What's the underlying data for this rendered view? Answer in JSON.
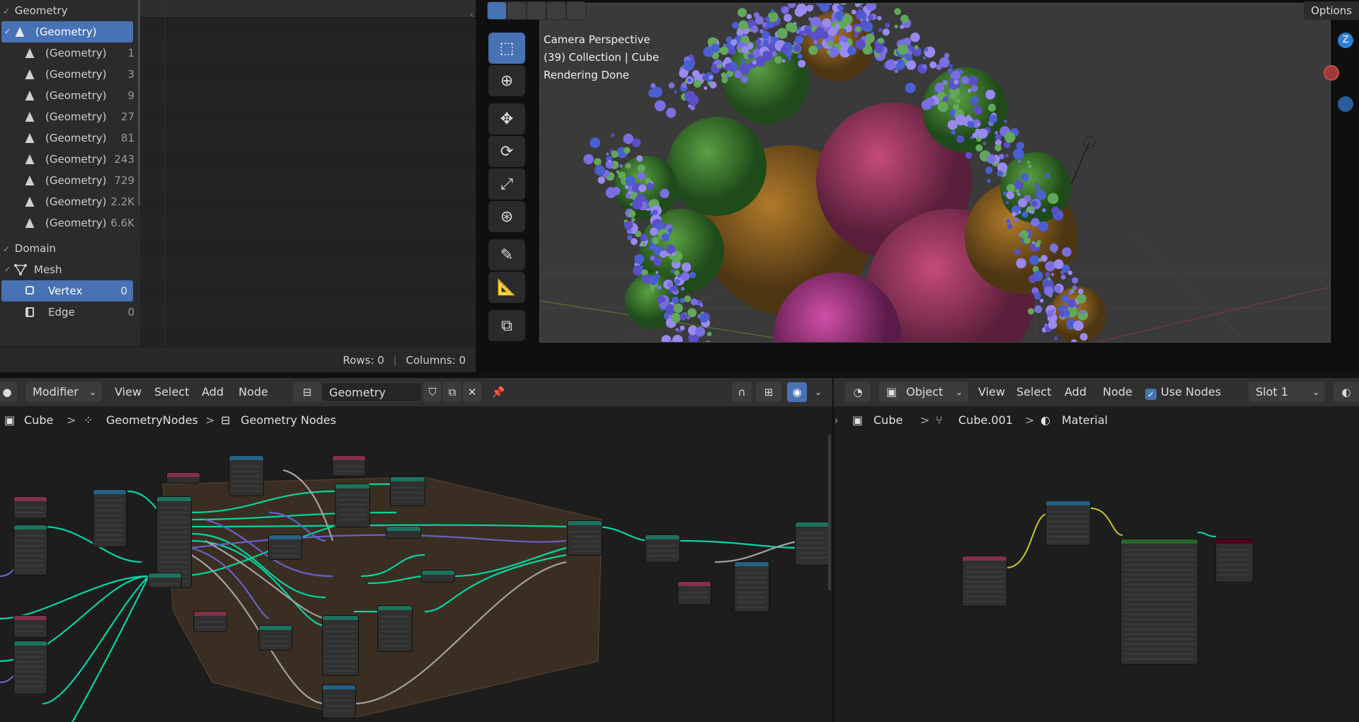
{
  "spreadsheet": {
    "sections": {
      "geometry": "Geometry",
      "domain": "Domain"
    },
    "geometry_items": [
      {
        "label": "(Geometry)",
        "count": ""
      },
      {
        "label": "(Geometry)",
        "count": "1"
      },
      {
        "label": "(Geometry)",
        "count": "3"
      },
      {
        "label": "(Geometry)",
        "count": "9"
      },
      {
        "label": "(Geometry)",
        "count": "27"
      },
      {
        "label": "(Geometry)",
        "count": "81"
      },
      {
        "label": "(Geometry)",
        "count": "243"
      },
      {
        "label": "(Geometry)",
        "count": "729"
      },
      {
        "label": "(Geometry)",
        "count": "2.2K"
      },
      {
        "label": "(Geometry)",
        "count": "6.6K"
      }
    ],
    "domain_items": {
      "mesh": "Mesh",
      "vertex": {
        "label": "Vertex",
        "count": "0"
      },
      "edge": {
        "label": "Edge",
        "count": "0"
      }
    },
    "footer": {
      "rows": "Rows: 0",
      "columns": "Columns: 0",
      "sep": "|"
    }
  },
  "viewport": {
    "info_lines": [
      "Camera Perspective",
      "(39) Collection | Cube",
      "Rendering Done"
    ],
    "options_label": "Options",
    "gizmo_z": "Z"
  },
  "geometry_editor": {
    "header": {
      "mode": "Modifier",
      "menus": [
        "View",
        "Select",
        "Add",
        "Node"
      ],
      "tree_name": "Geometry Nodes"
    },
    "breadcrumb": [
      "Cube",
      "GeometryNodes",
      "Geometry Nodes"
    ],
    "breadcrumb_sep": ">"
  },
  "shader_editor": {
    "header": {
      "mode": "Object",
      "menus": [
        "View",
        "Select",
        "Add",
        "Node"
      ],
      "use_nodes": "Use Nodes",
      "slot": "Slot 1"
    },
    "breadcrumb": [
      "Cube",
      "Cube.001",
      "Material"
    ],
    "breadcrumb_sep": ">"
  },
  "colors": {
    "accent": "#4772b3",
    "geometry_socket": "#00d6a3",
    "vector_socket": "#6363c7",
    "float_socket": "#a1a1a1",
    "color_socket": "#c7c729",
    "node_header_input": "#83314a",
    "node_header_geometry": "#1d725e",
    "node_header_converter": "#246283",
    "node_header_shader": "#2b652b",
    "node_header_output": "#4d0017",
    "frame": "#3a2e22"
  }
}
